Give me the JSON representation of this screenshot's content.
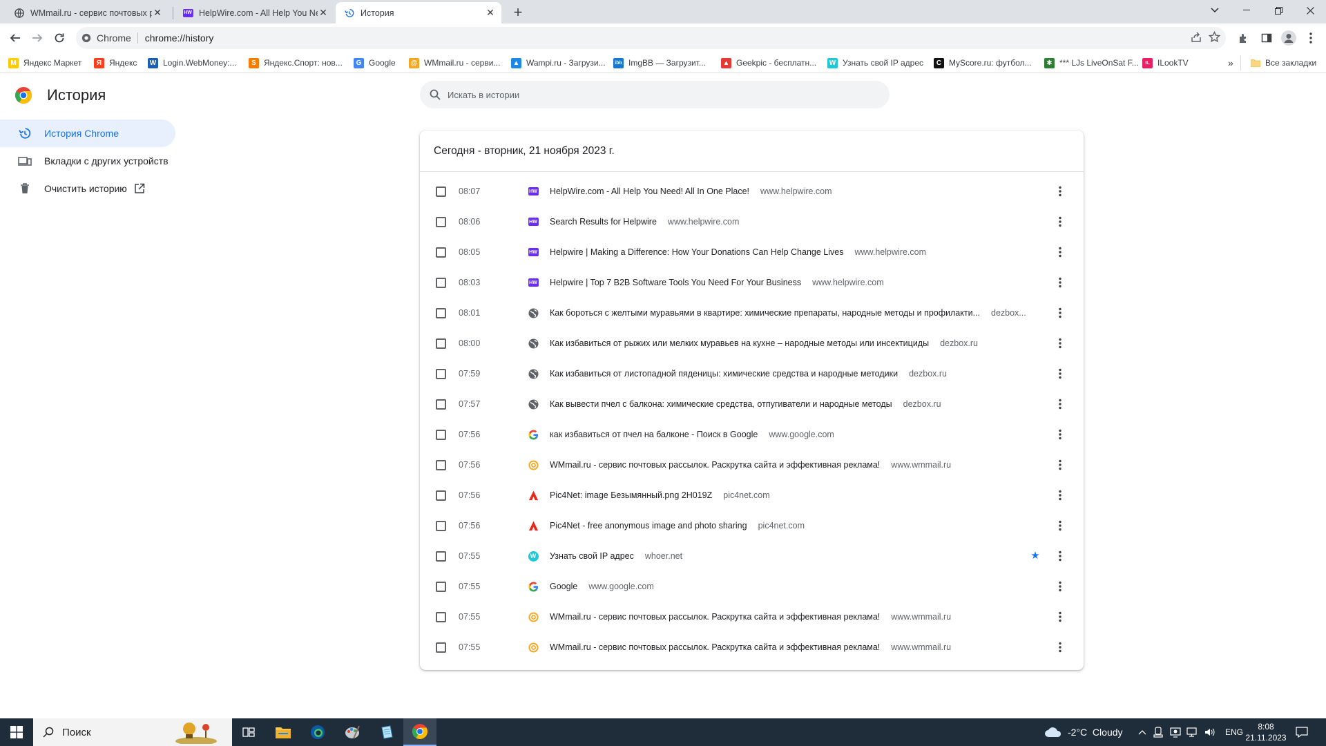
{
  "colors": {
    "accent": "#1a73e8",
    "tab_strip": "#dee1e6",
    "nav_selected_bg": "#e8f0fe",
    "taskbar": "#1f2d3a"
  },
  "tabs": [
    {
      "title": "WMmail.ru - сервис почтовых р",
      "icon": "globe-icon"
    },
    {
      "title": "HelpWire.com - All Help You Ne",
      "icon": "helpwire-icon"
    },
    {
      "title": "История",
      "icon": "history-icon",
      "active": true
    }
  ],
  "omnibox": {
    "chip": "Chrome",
    "url": "chrome://history"
  },
  "bookmarks": {
    "items": [
      {
        "label": "Яндекс Маркет",
        "icon": "yandex-market-icon",
        "color": "#ffcc00",
        "glyph": "M"
      },
      {
        "label": "Яндекс",
        "icon": "yandex-icon",
        "color": "#fc3f1d",
        "glyph": "Я"
      },
      {
        "label": "Login.WebMoney:...",
        "icon": "webmoney-icon",
        "color": "#1a5fb4",
        "glyph": "W"
      },
      {
        "label": "Яндекс.Спорт: нов...",
        "icon": "yandex-sport-icon",
        "color": "#f57c00",
        "glyph": "S"
      },
      {
        "label": "Google",
        "icon": "google-icon",
        "color": "#4285f4",
        "glyph": "G"
      },
      {
        "label": "WMmail.ru - серви...",
        "icon": "wmmail-icon",
        "color": "#f5a623",
        "glyph": "@"
      },
      {
        "label": "Wampi.ru - Загрузи...",
        "icon": "wampi-icon",
        "color": "#1e88e5",
        "glyph": "▲"
      },
      {
        "label": "ImgBB — Загрузит...",
        "icon": "imgbb-icon",
        "color": "#1976d2",
        "glyph": "ibb"
      },
      {
        "label": "Geekpic - бесплатн...",
        "icon": "geekpic-icon",
        "color": "#e53935",
        "glyph": "▲"
      },
      {
        "label": "Узнать свой IP адрес",
        "icon": "whoer-icon",
        "color": "#1ec8d4",
        "glyph": "W"
      },
      {
        "label": "MyScore.ru: футбол...",
        "icon": "myscore-icon",
        "color": "#111111",
        "glyph": "C"
      },
      {
        "label": "*** LJs LiveOnSat F...",
        "icon": "liveonsat-icon",
        "color": "#2e7d32",
        "glyph": "✱"
      },
      {
        "label": "ILookTV",
        "icon": "ilooktv-icon",
        "color": "#e91e63",
        "glyph": "IL"
      }
    ],
    "overflow": "»",
    "all_bookmarks": "Все закладки"
  },
  "page": {
    "title": "История",
    "nav": [
      {
        "label": "История Chrome",
        "icon": "history-icon",
        "selected": true
      },
      {
        "label": "Вкладки с других устройств",
        "icon": "devices-icon"
      },
      {
        "label": "Очистить историю",
        "icon": "trash-icon",
        "external": true
      }
    ],
    "search_placeholder": "Искать в истории",
    "date_header": "Сегодня - вторник, 21 ноября 2023 г."
  },
  "history": [
    {
      "time": "08:07",
      "title": "HelpWire.com - All Help You Need! All In One Place!",
      "domain": "www.helpwire.com",
      "favicon": "helpwire"
    },
    {
      "time": "08:06",
      "title": "Search Results for Helpwire",
      "domain": "www.helpwire.com",
      "favicon": "helpwire"
    },
    {
      "time": "08:05",
      "title": "Helpwire | Making a Difference: How Your Donations Can Help Change Lives",
      "domain": "www.helpwire.com",
      "favicon": "helpwire"
    },
    {
      "time": "08:03",
      "title": "Helpwire | Top 7 B2B Software Tools You Need For Your Business",
      "domain": "www.helpwire.com",
      "favicon": "helpwire"
    },
    {
      "time": "08:01",
      "title": "Как бороться с желтыми муравьями в квартире: химические препараты, народные методы и профилакти...",
      "domain": "dezbox...",
      "favicon": "globe"
    },
    {
      "time": "08:00",
      "title": "Как избавиться от рыжих или мелких муравьев на кухне – народные методы или инсектициды",
      "domain": "dezbox.ru",
      "favicon": "globe"
    },
    {
      "time": "07:59",
      "title": "Как избавиться от листопадной пяденицы: химические средства и народные методики",
      "domain": "dezbox.ru",
      "favicon": "globe"
    },
    {
      "time": "07:57",
      "title": "Как вывести пчел с балкона: химические средства, отпугиватели и народные методы",
      "domain": "dezbox.ru",
      "favicon": "globe"
    },
    {
      "time": "07:56",
      "title": "как избавиться от пчел на балконе - Поиск в Google",
      "domain": "www.google.com",
      "favicon": "google"
    },
    {
      "time": "07:56",
      "title": "WMmail.ru - сервис почтовых рассылок. Раскрутка сайта и эффективная реклама!",
      "domain": "www.wmmail.ru",
      "favicon": "wmmail"
    },
    {
      "time": "07:56",
      "title": "Pic4Net: image Безымянный.png 2H019Z",
      "domain": "pic4net.com",
      "favicon": "pic4net"
    },
    {
      "time": "07:56",
      "title": "Pic4Net - free anonymous image and photo sharing",
      "domain": "pic4net.com",
      "favicon": "pic4net"
    },
    {
      "time": "07:55",
      "title": "Узнать свой IP адрес",
      "domain": "whoer.net",
      "favicon": "whoer",
      "starred": true
    },
    {
      "time": "07:55",
      "title": "Google",
      "domain": "www.google.com",
      "favicon": "google"
    },
    {
      "time": "07:55",
      "title": "WMmail.ru - сервис почтовых рассылок. Раскрутка сайта и эффективная реклама!",
      "domain": "www.wmmail.ru",
      "favicon": "wmmail"
    },
    {
      "time": "07:55",
      "title": "WMmail.ru - сервис почтовых рассылок. Раскрутка сайта и эффективная реклама!",
      "domain": "www.wmmail.ru",
      "favicon": "wmmail"
    }
  ],
  "taskbar": {
    "search_label": "Поиск",
    "weather": "-2°C  Cloudy",
    "language": "ENG",
    "time": "8:08",
    "date": "21.11.2023"
  }
}
